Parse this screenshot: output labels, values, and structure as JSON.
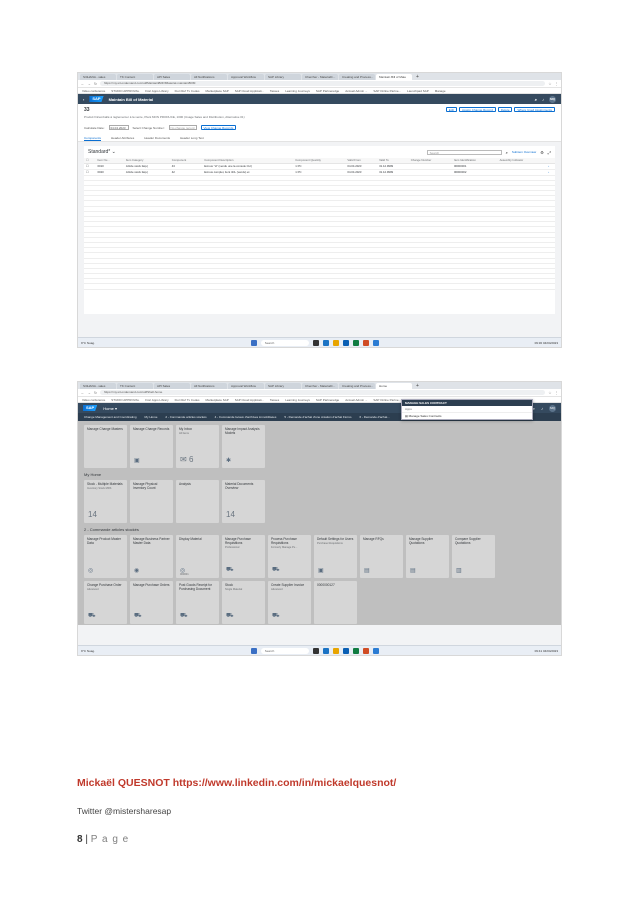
{
  "shot1": {
    "browser_tabs": [
      "S/4HANA - sales",
      "TK Content",
      "API Sales",
      "All Notifications",
      "Approval Workflow",
      "SAP Library",
      "Chercher - MaterialC...",
      "Creating and Process...",
      "Maintain Bill of Mate"
    ],
    "url": "https://my.s4.ondemand.com/ui#MaintainBillOfMaterial-maintainBOM",
    "bookmarks": [
      "Video conference",
      "STUDIO APPROVAL",
      "Fiori Apps Library",
      "Fiori Ref Tx Codes",
      "Marketplace SAP",
      "SAP Cloud Applicati...",
      "Tasses",
      "Learning Journeys",
      "SAP Partneredge",
      "Accueil Admin ...",
      "SAP Online Partne...",
      "Launchpad SAP",
      "Manage"
    ],
    "app_title": "Maintain Bill of Material",
    "object_id": "33",
    "object_subtitle": "Produit fini/emballé à réglementer à la vente, Plant MON PRODUCE, 1000 (Usage Sales and Distribution, Alternative 01)",
    "header_buttons": [
      "Edit",
      "Assign Change Record",
      "Delete",
      "Where Used Assignments"
    ],
    "valid_from_label": "Calculate Date:",
    "valid_from_value": "04.04.2023",
    "change_label": "Select Change Number:",
    "change_placeholder": "No change record",
    "view_change_button": "View Change Records",
    "subtabs": [
      "Components",
      "Header Attributes",
      "Header Documents",
      "Header Long Text"
    ],
    "table_title": "Standard",
    "table_search_placeholder": "Search",
    "table_link": "Subitem Overview",
    "columns": [
      "Item Nu...",
      "Item Category",
      "Component",
      "Component Description",
      "Component Quantity",
      "Valid From",
      "Valid To",
      "Change Number",
      "Item Identification",
      "Assembly Indicator"
    ],
    "rows": [
      [
        "0010",
        "Article stock lié(e)",
        "43",
        "Ecrous \"H\" (vendu une la console CLI)",
        "1",
        "PC",
        "04.04.2023",
        "31.12.9999",
        "",
        "00000001",
        ""
      ],
      [
        "0020",
        "Article stock lié(e)",
        "42",
        "Ecrous complet, lient 4CL (vendu) et",
        "1",
        "PC",
        "04.04.2023",
        "31.12.9999",
        "",
        "00000002",
        ""
      ]
    ],
    "taskbar_search": "Search",
    "weather": "9°C Nuag.",
    "clock": "09:30 04/04/2023"
  },
  "shot2": {
    "browser_tabs": [
      "S/4HANA - sales",
      "TK Content",
      "API Sales",
      "All Notifications",
      "Approval Workflow",
      "SAP Library",
      "Chercher - MaterialC...",
      "Creating and Process...",
      "Home"
    ],
    "url": "https://my.s4.ondemand.com/ui#Shell-home",
    "app_title": "Home",
    "search_value": "MANAGE SALES CONTRACT",
    "dropdown_label": "Apps",
    "dropdown_item": "Manage Sales Contracts",
    "spaces": [
      "Change Management and Coordinating",
      "My Home",
      "2 - Commande articles stockés",
      "4 - Commande locaux d'archives immobilisées",
      "5 - Demande d'achat d'une création d'achat Fiorno",
      "6 - Demande d'achat..."
    ],
    "row1": [
      {
        "title": "Manage Change Masters",
        "sub": "",
        "val": "",
        "icon": ""
      },
      {
        "title": "Manage Change Records",
        "sub": "",
        "val": "",
        "icon": "▣"
      },
      {
        "title": "My Inbox",
        "sub": "All Items",
        "val": "6",
        "icon": "✉"
      },
      {
        "title": "Manage Impact Analysis Models",
        "sub": "",
        "val": "",
        "icon": "✱"
      }
    ],
    "group_my_home": "My Home",
    "row2": [
      {
        "title": "Stock - Multiple Materials",
        "sub": "Inventory Stock MDS",
        "val": "14",
        "icon": ""
      },
      {
        "title": "Manage Physical Inventory Count",
        "sub": "",
        "val": "",
        "icon": ""
      },
      {
        "title": "Analysis",
        "sub": "",
        "val": "",
        "icon": ""
      },
      {
        "title": "Material Documents Overview",
        "sub": "",
        "val": "14",
        "icon": ""
      }
    ],
    "group_cmd": "2 - Commande articles stockés",
    "row3": [
      {
        "title": "Manage Product Master Data",
        "sub": "",
        "val": "",
        "icon": "◎"
      },
      {
        "title": "Manage Business Partner Master Data",
        "sub": "",
        "val": "",
        "icon": "◉"
      },
      {
        "title": "Display Material",
        "sub": "",
        "val": "",
        "icon": "◎"
      },
      {
        "title": "Manage Purchase Requisitions",
        "sub": "Professional",
        "val": "",
        "icon": "⛟"
      },
      {
        "title": "Process Purchase Requisitions",
        "sub": "Formerly Manage Pu...",
        "val": "",
        "icon": "⛟"
      },
      {
        "title": "Default Settings for Users",
        "sub": "Purchase Requisitions",
        "val": "",
        "icon": "▣"
      },
      {
        "title": "Manage RFQs",
        "sub": "",
        "val": "",
        "icon": "▤"
      },
      {
        "title": "Manage Supplier Quotations",
        "sub": "",
        "val": "",
        "icon": "▤"
      },
      {
        "title": "Compare Supplier Quotations",
        "sub": "",
        "val": "",
        "icon": "▥"
      }
    ],
    "row4": [
      {
        "title": "Change Purchase Order",
        "sub": "Advanced",
        "val": "",
        "icon": "⛟"
      },
      {
        "title": "Manage Purchase Orders",
        "sub": "",
        "val": "",
        "icon": "⛟"
      },
      {
        "title": "Post Goods Receipt for Purchasing Document",
        "sub": "",
        "val": "",
        "icon": "⛟"
      },
      {
        "title": "Stock",
        "sub": "Single Material",
        "val": "",
        "icon": "⛟"
      },
      {
        "title": "Create Supplier Invoice",
        "sub": "Advanced",
        "val": "",
        "icon": "⛟"
      },
      {
        "title": "0000000127",
        "sub": "",
        "val": "",
        "icon": ""
      }
    ],
    "row3_extra_sub": "000001",
    "taskbar_search": "Search",
    "weather": "9°C Nuag.",
    "clock": "09:41 04/04/2023"
  },
  "footer": {
    "author": "Mickaël QUESNOT https://www.linkedin.com/in/mickaelquesnot/",
    "twitter": "Twitter @mistersharesap",
    "page_number": "8",
    "page_sep": " | ",
    "page_word": "P a g e"
  }
}
